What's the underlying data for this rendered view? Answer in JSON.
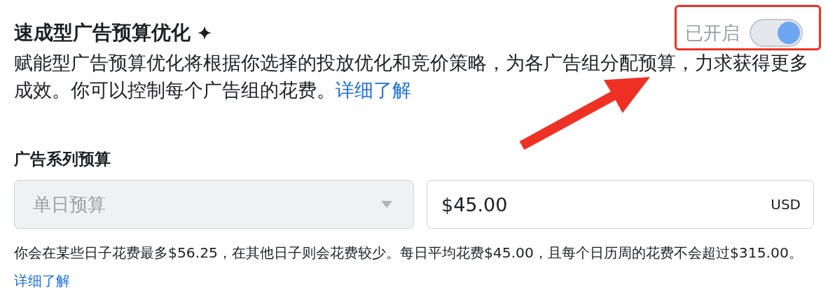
{
  "header": {
    "title": "速成型广告预算优化",
    "toggle": {
      "label": "已开启",
      "on": true
    }
  },
  "description": {
    "text": "赋能型广告预算优化将根据你选择的投放优化和竞价策略，为各广告组分配预算，力求获得更多成效。你可以控制每个广告组的花费。",
    "link": "详细了解"
  },
  "budget": {
    "label": "广告系列预算",
    "type_dropdown": {
      "value": "单日预算",
      "disabled": true
    },
    "amount_field": {
      "value": "$45.00",
      "currency": "USD"
    },
    "note": {
      "text": "你会在某些日子花费最多$56.25，在其他日子则会花费较少。每日平均花费$45.00，且每个日历周的花费不会超过$315.00。",
      "link": "详细了解"
    }
  }
}
